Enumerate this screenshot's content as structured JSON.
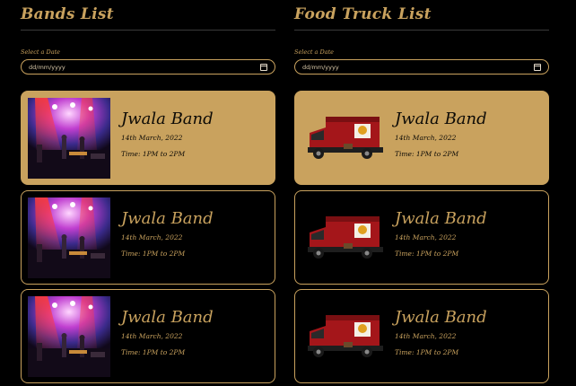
{
  "bands": {
    "title": "Bands List",
    "date_label": "Select a Date",
    "date_placeholder": "dd/mm/yyyy",
    "cards": [
      {
        "name": "Jwala Band",
        "date": "14th March, 2022",
        "time": "Time: 1PM to 2PM",
        "selected": true
      },
      {
        "name": "Jwala Band",
        "date": "14th March, 2022",
        "time": "Time: 1PM to 2PM",
        "selected": false
      },
      {
        "name": "Jwala Band",
        "date": "14th March, 2022",
        "time": "Time: 1PM to 2PM",
        "selected": false
      }
    ]
  },
  "food_trucks": {
    "title": "Food Truck List",
    "date_label": "Select a Date",
    "date_placeholder": "dd/mm/yyyy",
    "cards": [
      {
        "name": "Jwala Band",
        "date": "14th March, 2022",
        "time": "Time: 1PM to 2PM",
        "selected": true
      },
      {
        "name": "Jwala Band",
        "date": "14th March, 2022",
        "time": "Time: 1PM to 2PM",
        "selected": false
      },
      {
        "name": "Jwala Band",
        "date": "14th March, 2022",
        "time": "Time: 1PM to 2PM",
        "selected": false
      }
    ]
  },
  "colors": {
    "accent": "#c9a25e",
    "background": "#000000",
    "selected_card_text": "#0c0a06"
  },
  "icons": {
    "date_picker": "calendar-icon",
    "band_image": "concert-stage-photo",
    "truck_image": "food-truck-photo"
  }
}
